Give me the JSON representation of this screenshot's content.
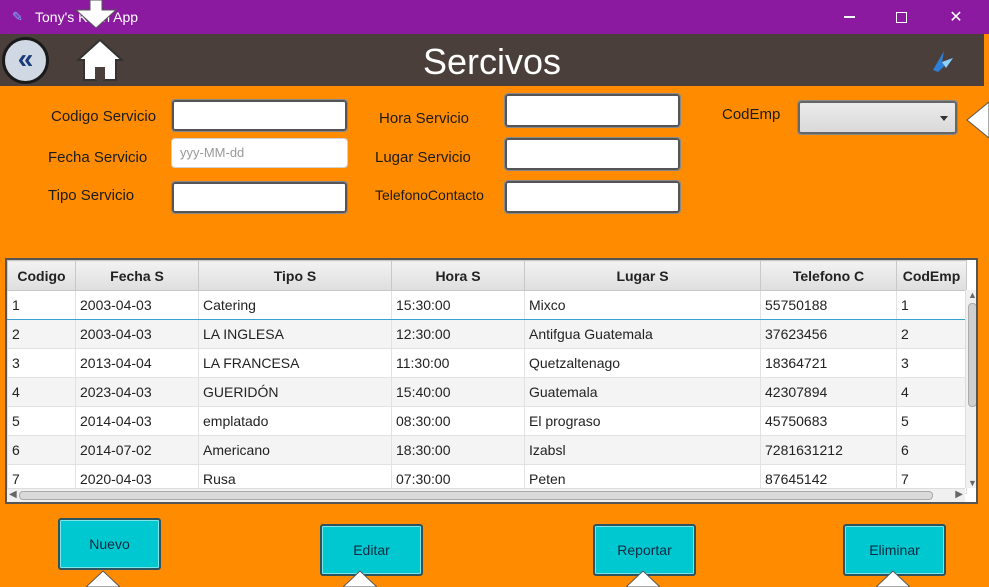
{
  "window": {
    "title": "Tony's Kash App",
    "app_icon": "feather-icon",
    "controls": {
      "minimize": "minimize-icon",
      "maximize": "maximize-icon",
      "close_glyph": "✕"
    }
  },
  "header": {
    "title": "Sercivos",
    "back_glyph": "«",
    "home_icon": "home-icon",
    "brand_icon": "brand-logo-icon",
    "background": "#4a3f3a"
  },
  "form": {
    "codigo_label": "Codigo Servicio",
    "fecha_label": "Fecha Servicio",
    "fecha_placeholder": "yyy-MM-dd",
    "tipo_label": "Tipo Servicio",
    "hora_label": "Hora Servicio",
    "lugar_label": "Lugar Servicio",
    "telefono_label": "TelefonoContacto",
    "codemp_label": "CodEmp"
  },
  "table": {
    "columns": [
      "Codigo",
      "Fecha S",
      "Tipo S",
      "Hora  S",
      "Lugar S",
      "Telefono C",
      "CodEmp"
    ],
    "rows": [
      [
        "1",
        "2003-04-03",
        "Catering",
        "15:30:00",
        "Mixco",
        "55750188",
        "1"
      ],
      [
        "2",
        "2003-04-03",
        "LA INGLESA",
        "12:30:00",
        "Antifgua Guatemala",
        "37623456",
        "2"
      ],
      [
        "3",
        "2013-04-04",
        "LA FRANCESA",
        "11:30:00",
        "Quetzaltenago",
        "18364721",
        "3"
      ],
      [
        "4",
        "2023-04-03",
        "GUERIDÓN",
        "15:40:00",
        "Guatemala",
        "42307894",
        "4"
      ],
      [
        "5",
        "2014-04-03",
        "emplatado",
        "08:30:00",
        "El prograso",
        "45750683",
        "5"
      ],
      [
        "6",
        "2014-07-02",
        "Americano",
        "18:30:00",
        "Izabsl",
        "7281631212",
        "6"
      ],
      [
        "7",
        "2020-04-03",
        "Rusa",
        "07:30:00",
        "Peten",
        "87645142",
        "7"
      ]
    ]
  },
  "buttons": {
    "nuevo": "Nuevo",
    "editar": "Editar",
    "reportar": "Reportar",
    "eliminar": "Eliminar"
  },
  "colors": {
    "background": "#ff8c00",
    "titlebar": "#8b1aa0",
    "button": "#00c8d0"
  }
}
